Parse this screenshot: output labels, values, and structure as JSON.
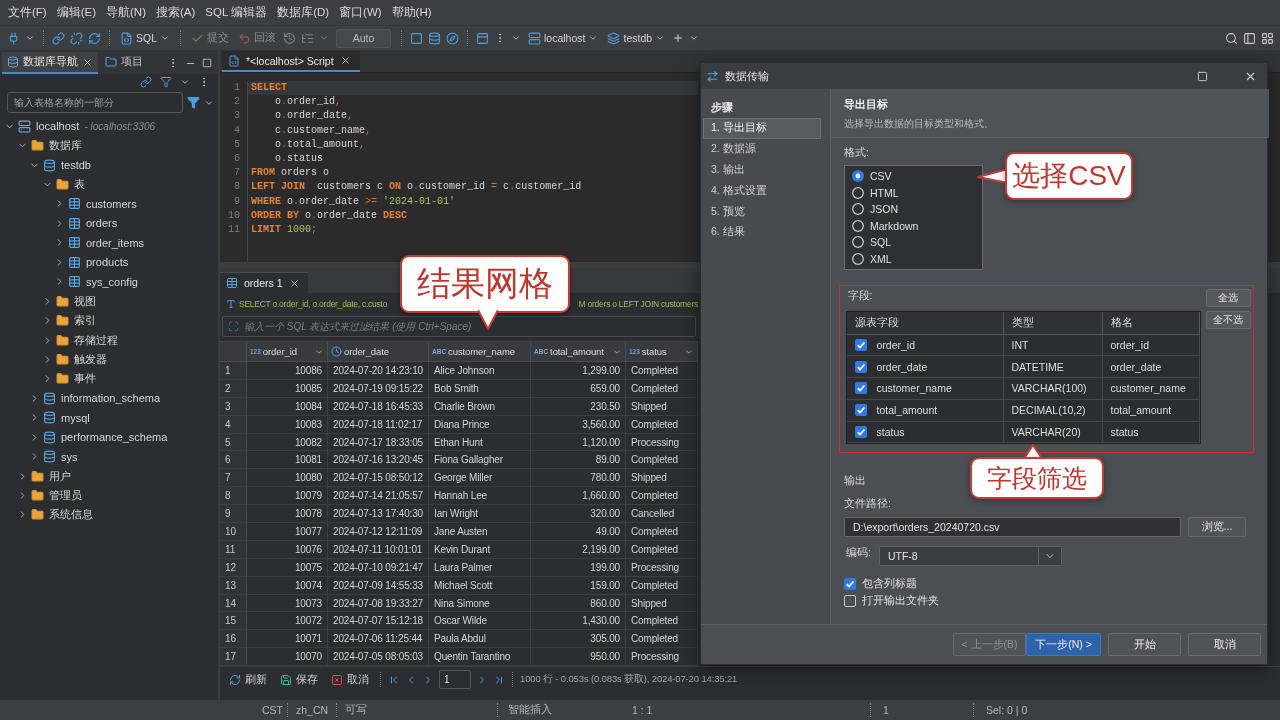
{
  "menu_bar": [
    "文件(F)",
    "编辑(E)",
    "导航(N)",
    "搜索(A)",
    "SQL 编辑器",
    "数据库(D)",
    "窗口(W)",
    "帮助(H)"
  ],
  "toolbar": {
    "editor_button": "SQL",
    "commit": {
      "label": "提交",
      "disabled": true
    },
    "rollback": {
      "label": "回滚",
      "disabled": true
    },
    "transaction_mode": "Auto",
    "connection": "localhost",
    "database": "testdb"
  },
  "navigator": {
    "tabs": [
      {
        "label": "数据库导航",
        "selected": true
      },
      {
        "label": "项目",
        "selected": false
      }
    ],
    "filter": {
      "placeholder": "输入表格名称的一部分"
    },
    "tree": [
      {
        "label": "localhost",
        "note": "- localhost:3306",
        "kind": "connection",
        "expanded": true,
        "children": [
          {
            "label": "数据库",
            "kind": "folder",
            "expanded": true,
            "children": [
              {
                "label": "testdb",
                "kind": "database",
                "expanded": true,
                "children": [
                  {
                    "label": "表",
                    "kind": "folder",
                    "expanded": true,
                    "children": [
                      {
                        "label": "customers",
                        "kind": "table",
                        "expanded": false
                      },
                      {
                        "label": "orders",
                        "kind": "table",
                        "expanded": false
                      },
                      {
                        "label": "order_items",
                        "kind": "table",
                        "expanded": false
                      },
                      {
                        "label": "products",
                        "kind": "table",
                        "expanded": false
                      },
                      {
                        "label": "sys_config",
                        "kind": "table",
                        "expanded": false
                      }
                    ]
                  },
                  {
                    "label": "视图",
                    "kind": "folder",
                    "expanded": false
                  },
                  {
                    "label": "索引",
                    "kind": "folder",
                    "expanded": false
                  },
                  {
                    "label": "存储过程",
                    "kind": "folder",
                    "expanded": false
                  },
                  {
                    "label": "触发器",
                    "kind": "folder",
                    "expanded": false
                  },
                  {
                    "label": "事件",
                    "kind": "folder",
                    "expanded": false
                  }
                ]
              },
              {
                "label": "information_schema",
                "kind": "database",
                "expanded": false
              },
              {
                "label": "mysql",
                "kind": "database",
                "expanded": false
              },
              {
                "label": "performance_schema",
                "kind": "database",
                "expanded": false
              },
              {
                "label": "sys",
                "kind": "database",
                "expanded": false
              }
            ]
          },
          {
            "label": "用户",
            "kind": "folder",
            "expanded": false
          },
          {
            "label": "管理员",
            "kind": "folder",
            "expanded": false
          },
          {
            "label": "系统信息",
            "kind": "folder",
            "expanded": false
          }
        ]
      }
    ]
  },
  "editor": {
    "tab": {
      "label": "*<localhost> Script",
      "selected": true
    },
    "lines": [
      {
        "number": "1",
        "current": true,
        "tokens": [
          {
            "kind": "keyword",
            "text": "SELECT"
          }
        ]
      },
      {
        "number": "2",
        "current": false,
        "tokens": [
          {
            "kind": "plain",
            "text": "    o"
          },
          {
            "kind": "punct",
            "text": "."
          },
          {
            "kind": "plain",
            "text": "order_id"
          },
          {
            "kind": "punct",
            "text": ","
          }
        ]
      },
      {
        "number": "3",
        "current": false,
        "tokens": [
          {
            "kind": "plain",
            "text": "    o"
          },
          {
            "kind": "punct",
            "text": "."
          },
          {
            "kind": "plain",
            "text": "order_date"
          },
          {
            "kind": "punct",
            "text": ","
          }
        ]
      },
      {
        "number": "4",
        "current": false,
        "tokens": [
          {
            "kind": "plain",
            "text": "    c"
          },
          {
            "kind": "punct",
            "text": "."
          },
          {
            "kind": "plain",
            "text": "customer_name"
          },
          {
            "kind": "punct",
            "text": ","
          }
        ]
      },
      {
        "number": "5",
        "current": false,
        "tokens": [
          {
            "kind": "plain",
            "text": "    o"
          },
          {
            "kind": "punct",
            "text": "."
          },
          {
            "kind": "plain",
            "text": "total_amount"
          },
          {
            "kind": "punct",
            "text": ","
          }
        ]
      },
      {
        "number": "6",
        "current": false,
        "tokens": [
          {
            "kind": "plain",
            "text": "    o"
          },
          {
            "kind": "punct",
            "text": "."
          },
          {
            "kind": "plain",
            "text": "status"
          }
        ]
      },
      {
        "number": "7",
        "current": false,
        "tokens": [
          {
            "kind": "keyword",
            "text": "FROM"
          },
          {
            "kind": "plain",
            "text": " orders o"
          }
        ]
      },
      {
        "number": "8",
        "current": false,
        "tokens": [
          {
            "kind": "keyword",
            "text": "LEFT JOIN"
          },
          {
            "kind": "plain",
            "text": "  customers c "
          },
          {
            "kind": "keyword",
            "text": "ON"
          },
          {
            "kind": "plain",
            "text": " o"
          },
          {
            "kind": "punct",
            "text": "."
          },
          {
            "kind": "plain",
            "text": "customer_id "
          },
          {
            "kind": "punct",
            "text": "="
          },
          {
            "kind": "plain",
            "text": " c"
          },
          {
            "kind": "punct",
            "text": "."
          },
          {
            "kind": "plain",
            "text": "customer_id"
          }
        ]
      },
      {
        "number": "9",
        "current": false,
        "tokens": [
          {
            "kind": "keyword",
            "text": "WHERE"
          },
          {
            "kind": "plain",
            "text": " o"
          },
          {
            "kind": "punct",
            "text": "."
          },
          {
            "kind": "plain",
            "text": "order_date "
          },
          {
            "kind": "punct",
            "text": ">="
          },
          {
            "kind": "string",
            "text": " '2024-01-01'"
          }
        ]
      },
      {
        "number": "10",
        "current": false,
        "tokens": [
          {
            "kind": "keyword",
            "text": "ORDER BY"
          },
          {
            "kind": "plain",
            "text": " o"
          },
          {
            "kind": "punct",
            "text": "."
          },
          {
            "kind": "plain",
            "text": "order_date "
          },
          {
            "kind": "keyword",
            "text": "DESC"
          }
        ]
      },
      {
        "number": "11",
        "current": false,
        "tokens": [
          {
            "kind": "keyword",
            "text": "LIMIT"
          },
          {
            "kind": "number",
            "text": " 1000"
          },
          {
            "kind": "punct",
            "text": ";"
          }
        ]
      }
    ]
  },
  "results": {
    "tab": {
      "label": "orders 1",
      "selected": true
    },
    "callout": "结果网格",
    "query_parts": [
      "SELECT o.order_id, o.order_date, c.custo",
      "M orders o LEFT JOIN customers"
    ],
    "filter": {
      "placeholder": "输入一个 SQL 表达式来过滤结果 (使用 Ctrl+Space)"
    },
    "columns": [
      {
        "label": "order_id",
        "kind": "number",
        "type_label": "123",
        "menu": true
      },
      {
        "label": "order_date",
        "kind": "datetime",
        "menu": false
      },
      {
        "label": "customer_name",
        "kind": "text",
        "type_label": "ABC",
        "menu": false
      },
      {
        "label": "total_amount",
        "kind": "text",
        "type_label": "ABC",
        "menu": true
      },
      {
        "label": "status",
        "kind": "number",
        "type_label": "123",
        "menu": true
      }
    ],
    "rows": [
      {
        "number": "1",
        "cells": [
          "10086",
          "2024-07-20 14:23:10",
          "Alice Johnson",
          "1,299.00",
          "Completed"
        ]
      },
      {
        "number": "2",
        "cells": [
          "10085",
          "2024-07-19 09:15:22",
          "Bob Smith",
          "659.00",
          "Completed"
        ]
      },
      {
        "number": "3",
        "cells": [
          "10084",
          "2024-07-18 16:45:33",
          "Charlie Brown",
          "230.50",
          "Shipped"
        ]
      },
      {
        "number": "4",
        "cells": [
          "10083",
          "2024-07-18 11:02:17",
          "Diana Prince",
          "3,560.00",
          "Completed"
        ]
      },
      {
        "number": "5",
        "cells": [
          "10082",
          "2024-07-17 18:33:05",
          "Ethan Hunt",
          "1,120.00",
          "Processing"
        ]
      },
      {
        "number": "6",
        "cells": [
          "10081",
          "2024-07-16 13:20:45",
          "Fiona Gallagher",
          "89.00",
          "Completed"
        ]
      },
      {
        "number": "7",
        "cells": [
          "10080",
          "2024-07-15 08:50:12",
          "George Miller",
          "780.00",
          "Shipped"
        ]
      },
      {
        "number": "8",
        "cells": [
          "10079",
          "2024-07-14 21:05:57",
          "Hannah Lee",
          "1,660.00",
          "Completed"
        ]
      },
      {
        "number": "9",
        "cells": [
          "10078",
          "2024-07-13 17:40:30",
          "Ian Wright",
          "320.00",
          "Cancelled"
        ]
      },
      {
        "number": "10",
        "cells": [
          "10077",
          "2024-07-12 12:11:09",
          "Jane Austen",
          "49.00",
          "Completed"
        ]
      },
      {
        "number": "11",
        "cells": [
          "10076",
          "2024-07-11 10:01:01",
          "Kevin Durant",
          "2,199.00",
          "Completed"
        ]
      },
      {
        "number": "12",
        "cells": [
          "10075",
          "2024-07-10 09:21:47",
          "Laura Palmer",
          "199.00",
          "Processing"
        ]
      },
      {
        "number": "13",
        "cells": [
          "10074",
          "2024-07-09 14:55:33",
          "Michael Scott",
          "159.00",
          "Completed"
        ]
      },
      {
        "number": "14",
        "cells": [
          "10073",
          "2024-07-08 19:33:27",
          "Nina Simone",
          "860.00",
          "Shipped"
        ]
      },
      {
        "number": "15",
        "cells": [
          "10072",
          "2024-07-07 15:12:18",
          "Oscar Wilde",
          "1,430.00",
          "Completed"
        ]
      },
      {
        "number": "16",
        "cells": [
          "10071",
          "2024-07-06 11:25:44",
          "Paula Abdul",
          "305.00",
          "Completed"
        ]
      },
      {
        "number": "17",
        "cells": [
          "10070",
          "2024-07-05 08:05:03",
          "Quentin Tarantino",
          "950.00",
          "Processing"
        ]
      }
    ],
    "footer": {
      "buttons": [
        {
          "label": "刷新",
          "kind": "refresh"
        },
        {
          "label": "保存",
          "kind": "save"
        },
        {
          "label": "取消",
          "kind": "cancel"
        }
      ],
      "page": "1",
      "summary": "1000 行 - 0.053s (0.083s 获取), 2024-07-20 14:35:21"
    }
  },
  "status_bar": [
    "CST",
    "zh_CN",
    "可写",
    "智能插入",
    "1 : 1",
    "1",
    "Sel: 0 | 0"
  ],
  "dialog": {
    "title": "数据传输",
    "steps_title": "步骤",
    "steps": [
      {
        "label": "1. 导出目标",
        "selected": true
      },
      {
        "label": "2. 数据源",
        "selected": false
      },
      {
        "label": "3. 输出",
        "selected": false
      },
      {
        "label": "4. 格式设置",
        "selected": false
      },
      {
        "label": "5. 预览",
        "selected": false
      },
      {
        "label": "6. 结果",
        "selected": false
      }
    ],
    "page_title": "导出目标",
    "page_subtitle": "选择导出数据的目标类型和格式。",
    "format": {
      "label": "格式:",
      "options": [
        {
          "label": "CSV",
          "selected": true
        },
        {
          "label": "HTML",
          "selected": false
        },
        {
          "label": "JSON",
          "selected": false
        },
        {
          "label": "Markdown",
          "selected": false
        },
        {
          "label": "SQL",
          "selected": false
        },
        {
          "label": "XML",
          "selected": false
        }
      ],
      "callout": "选择CSV"
    },
    "fields": {
      "label": "字段:",
      "select_all": "全选",
      "select_none": "全不选",
      "columns": [
        "源表字段",
        "类型",
        "格名"
      ],
      "rows": [
        {
          "checked": true,
          "source": "order_id",
          "type": "INT",
          "target": "order_id"
        },
        {
          "checked": true,
          "source": "order_date",
          "type": "DATETIME",
          "target": "order_date"
        },
        {
          "checked": true,
          "source": "customer_name",
          "type": "VARCHAR(100)",
          "target": "customer_name"
        },
        {
          "checked": true,
          "source": "total_amount",
          "type": "DECIMAL(10,2)",
          "target": "total_amount"
        },
        {
          "checked": true,
          "source": "status",
          "type": "VARCHAR(20)",
          "target": "status"
        }
      ],
      "callout": "字段筛选"
    },
    "output": {
      "title": "输出",
      "path_label": "文件路径:",
      "path": "D:\\export\\orders_20240720.csv",
      "browse": "浏览...",
      "encoding_label": "编码:",
      "encoding": "UTF-8",
      "options": [
        {
          "label": "包含列标题",
          "checked": true
        },
        {
          "label": "打开输出文件夹",
          "checked": false
        }
      ]
    },
    "buttons": [
      {
        "label": "< 上一步(B)",
        "kind": "secondary",
        "disabled": true
      },
      {
        "label": "下一步(N) >",
        "kind": "primary",
        "disabled": false
      },
      {
        "label": "开始",
        "kind": "secondary",
        "disabled": false
      },
      {
        "label": "取消",
        "kind": "secondary",
        "disabled": false
      }
    ]
  }
}
